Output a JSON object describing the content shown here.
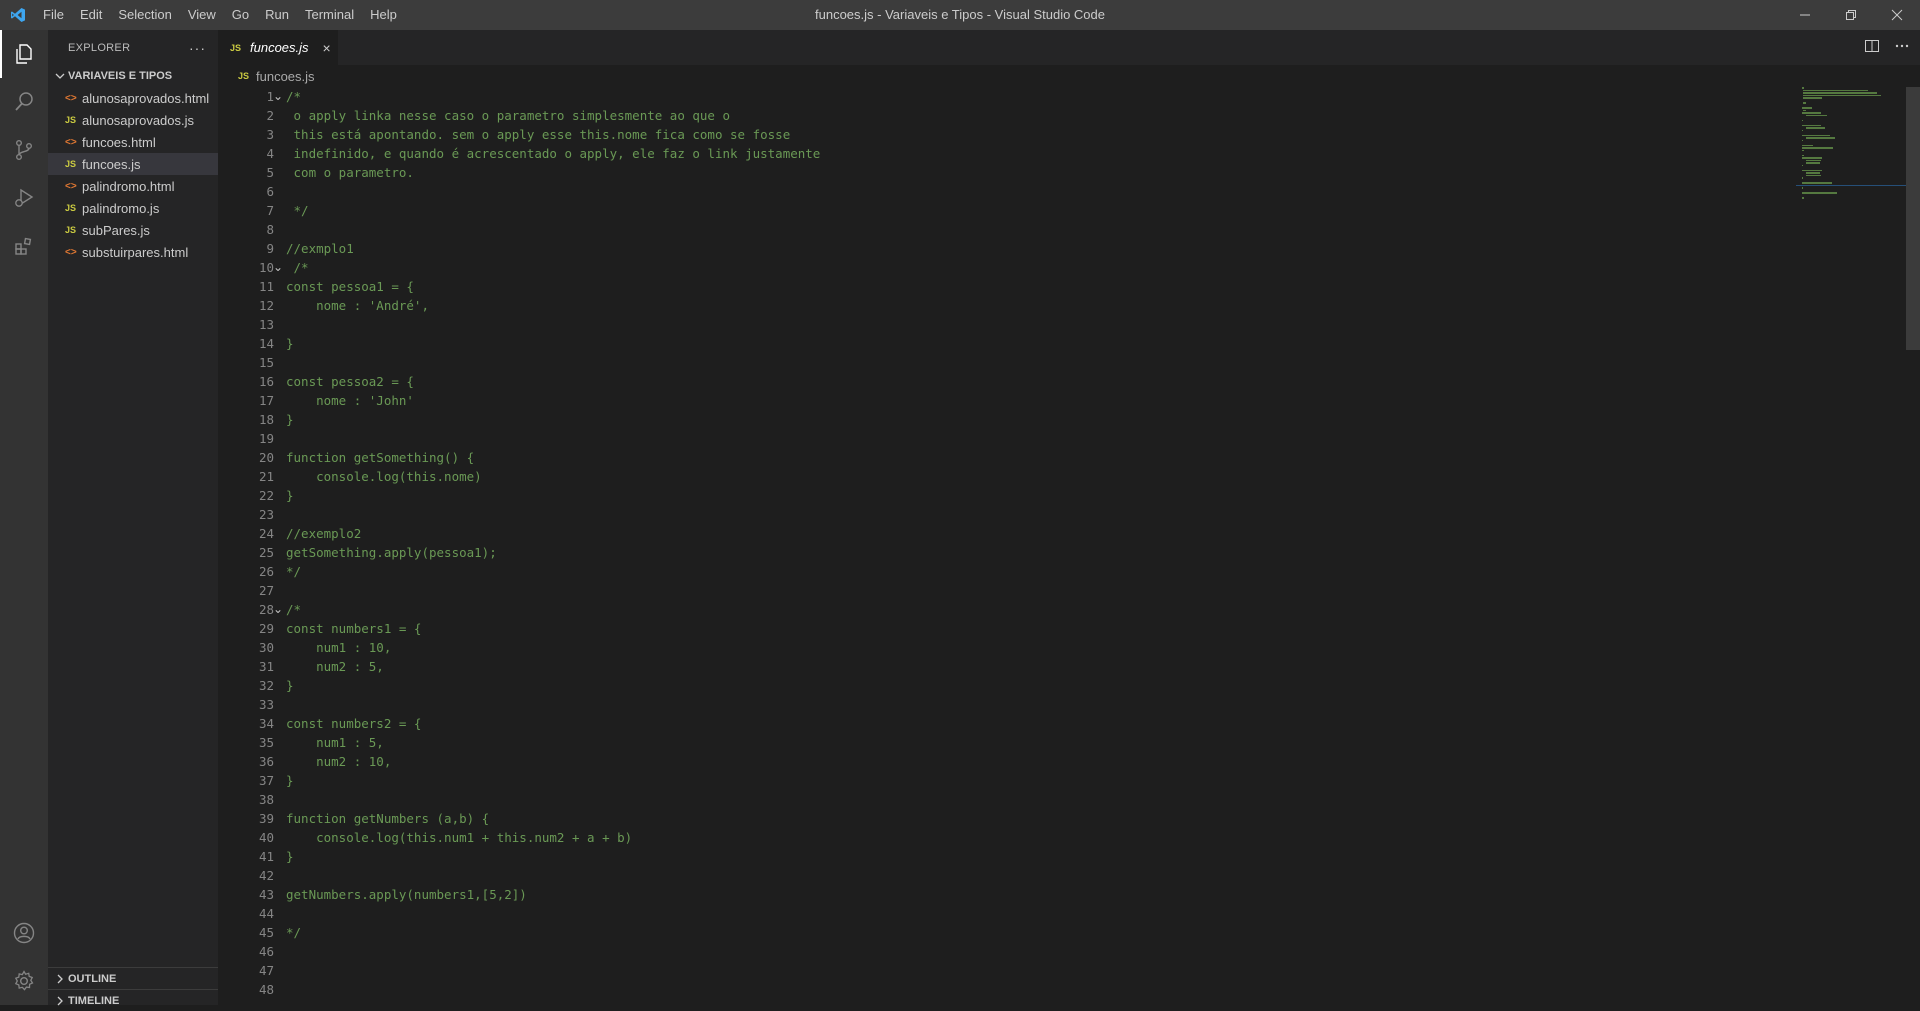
{
  "titlebar": {
    "menu": [
      "File",
      "Edit",
      "Selection",
      "View",
      "Go",
      "Run",
      "Terminal",
      "Help"
    ],
    "title": "funcoes.js - Variaveis e Tipos - Visual Studio Code",
    "controls": [
      "minimize-icon",
      "restore-icon",
      "close-icon"
    ]
  },
  "activitybar": {
    "top": [
      "files-icon",
      "search-icon",
      "source-control-icon",
      "run-debug-icon",
      "extensions-icon"
    ],
    "bottom": [
      "account-icon",
      "gear-icon"
    ]
  },
  "sidebar": {
    "title": "EXPLORER",
    "more": "···",
    "folder": "VARIAVEIS E TIPOS",
    "files": [
      {
        "name": "alunosaprovados.html",
        "type": "html",
        "badge": "<>"
      },
      {
        "name": "alunosaprovados.js",
        "type": "js",
        "badge": "JS"
      },
      {
        "name": "funcoes.html",
        "type": "html",
        "badge": "<>"
      },
      {
        "name": "funcoes.js",
        "type": "js",
        "badge": "JS",
        "active": true
      },
      {
        "name": "palindromo.html",
        "type": "html",
        "badge": "<>"
      },
      {
        "name": "palindromo.js",
        "type": "js",
        "badge": "JS"
      },
      {
        "name": "subPares.js",
        "type": "js",
        "badge": "JS"
      },
      {
        "name": "substuirpares.html",
        "type": "html",
        "badge": "<>"
      }
    ],
    "panels": [
      "OUTLINE",
      "TIMELINE"
    ]
  },
  "tabs": [
    {
      "badge": "JS",
      "label": "funcoes.js",
      "close": "×"
    }
  ],
  "breadcrumb": {
    "badge": "JS",
    "file": "funcoes.js"
  },
  "editor": {
    "lines": [
      "/*",
      " o apply linka nesse caso o parametro simplesmente ao que o",
      " this está apontando. sem o apply esse this.nome fica como se fosse",
      " indefinido, e quando é acrescentado o apply, ele faz o link justamente",
      " com o parametro.",
      "",
      " */",
      "",
      "//exmplo1",
      " /*",
      "const pessoa1 = {",
      "    nome : 'André',",
      "",
      "}",
      "",
      "const pessoa2 = {",
      "    nome : 'John'",
      "}",
      "",
      "function getSomething() {",
      "    console.log(this.nome)",
      "}",
      "",
      "//exemplo2",
      "getSomething.apply(pessoa1);",
      "*/",
      "",
      "/*",
      "const numbers1 = {",
      "    num1 : 10,",
      "    num2 : 5,",
      "}",
      "",
      "const numbers2 = {",
      "    num1 : 5,",
      "    num2 : 10,",
      "}",
      "",
      "function getNumbers (a,b) {",
      "    console.log(this.num1 + this.num2 + a + b)",
      "}",
      "",
      "getNumbers.apply(numbers1,[5,2])",
      "",
      "*/",
      "",
      "",
      ""
    ],
    "folded_lines": [
      1,
      10,
      28
    ],
    "fold_glyph": "⌄",
    "comment_color": "#6a9955"
  }
}
